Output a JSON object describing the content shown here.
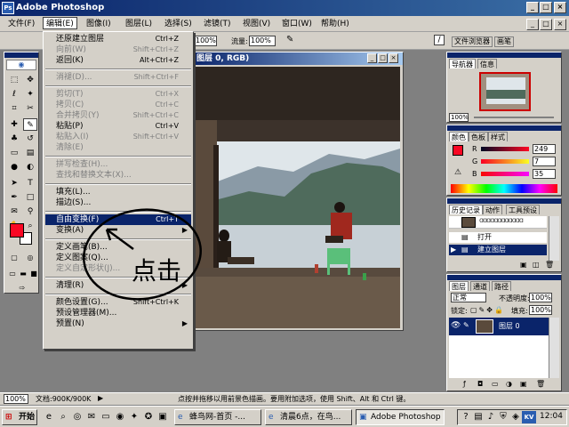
{
  "app": {
    "title": "Adobe Photoshop",
    "ps_logo": "Ps"
  },
  "window_controls": {
    "minimize": "_",
    "maximize": "□",
    "close": "×"
  },
  "menubar": [
    {
      "label": "文件(F)"
    },
    {
      "label": "编辑(E)"
    },
    {
      "label": "图像(I)"
    },
    {
      "label": "图层(L)"
    },
    {
      "label": "选择(S)"
    },
    {
      "label": "滤镜(T)"
    },
    {
      "label": "视图(V)"
    },
    {
      "label": "窗口(W)"
    },
    {
      "label": "帮助(H)"
    }
  ],
  "options": {
    "zoom_value": "100%",
    "flow_label": "流量:",
    "flow_value": "100%"
  },
  "palette_well": {
    "tab1": "文件浏览器",
    "tab2": "画笔"
  },
  "image_window": {
    "title": "图层 0, RGB)"
  },
  "edit_menu": {
    "items": [
      {
        "label": "还原建立图层",
        "shortcut": "Ctrl+Z"
      },
      {
        "label": "向前(W)",
        "shortcut": "Shift+Ctrl+Z"
      },
      {
        "label": "返回(K)",
        "shortcut": "Alt+Ctrl+Z"
      },
      {
        "label": "消褪(D)...",
        "shortcut": "Shift+Ctrl+F"
      },
      {
        "label": "剪切(T)",
        "shortcut": "Ctrl+X"
      },
      {
        "label": "拷贝(C)",
        "shortcut": "Ctrl+C"
      },
      {
        "label": "合并拷贝(Y)",
        "shortcut": "Shift+Ctrl+C"
      },
      {
        "label": "粘贴(P)",
        "shortcut": "Ctrl+V"
      },
      {
        "label": "粘贴入(I)",
        "shortcut": "Shift+Ctrl+V"
      },
      {
        "label": "清除(E)"
      },
      {
        "label": "拼写检查(H)..."
      },
      {
        "label": "查找和替换文本(X)..."
      },
      {
        "label": "填充(L)..."
      },
      {
        "label": "描边(S)..."
      },
      {
        "label": "自由变换(F)",
        "shortcut": "Ctrl+T"
      },
      {
        "label": "变换(A)"
      },
      {
        "label": "定义画笔(B)..."
      },
      {
        "label": "定义图案(Q)..."
      },
      {
        "label": "定义自定形状(J)..."
      },
      {
        "label": "清理(R)"
      },
      {
        "label": "颜色设置(G)...",
        "shortcut": "Shift+Ctrl+K"
      },
      {
        "label": "预设管理器(M)..."
      },
      {
        "label": "预置(N)"
      }
    ],
    "submenu_arrow": "▶"
  },
  "annotation": {
    "text": "点击"
  },
  "navigator": {
    "tab1": "导航器",
    "tab2": "信息",
    "zoom": "100%"
  },
  "color_panel": {
    "tab1": "颜色",
    "tab2": "色板",
    "tab3": "样式",
    "r_label": "R",
    "g_label": "G",
    "b_label": "B",
    "r": "249",
    "g": "7",
    "b": "35",
    "foreground": "#f90723"
  },
  "history": {
    "tab1": "历史记录",
    "tab2": "动作",
    "tab3": "工具预设",
    "items": [
      {
        "label": "打开"
      },
      {
        "label": "建立图层"
      }
    ]
  },
  "layers": {
    "tab1": "图层",
    "tab2": "通道",
    "tab3": "路径",
    "blend_mode": "正常",
    "opacity_label": "不透明度:",
    "opacity": "100%",
    "lock_label": "锁定:",
    "fill_label": "填充:",
    "fill": "100%",
    "layer_name": "图层 0"
  },
  "status": {
    "zoom": "100%",
    "doc": "文档:900K/900K",
    "hint": "点按并拖移以用前景色描画。要用附加选项，使用 Shift、Alt 和 Ctrl 键。"
  },
  "taskbar": {
    "start": "开始",
    "tasks": [
      {
        "label": "蜂鸟网-首页 -..."
      },
      {
        "label": "清晨6点，在鸟..."
      },
      {
        "label": "Adobe Photoshop"
      }
    ],
    "time": "12:04",
    "kv_label": "KV"
  }
}
